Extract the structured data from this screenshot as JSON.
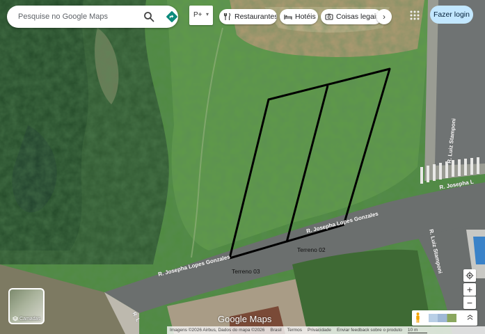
{
  "search": {
    "placeholder": "Pesquise no Google Maps",
    "search_icon": "search-icon",
    "directions_icon": "directions-icon"
  },
  "layer_picker": {
    "glyph": "P+",
    "caret": "▾"
  },
  "chips": [
    {
      "label": "Restaurantes",
      "icon": "restaurant-icon"
    },
    {
      "label": "Hotéis",
      "icon": "hotel-icon"
    },
    {
      "label": "Coisas legais p",
      "icon": "camera-icon"
    }
  ],
  "chip_next": "›",
  "login_label": "Fazer login",
  "layers_label": "Camadas",
  "street_labels": {
    "josepha_main": "R. Josepha Lopes Gonzales",
    "josepha_right": "R. Josepha Lopes Gonzales",
    "josepha_far": "R. Josepha L",
    "luiz_top": "R. Luiz Stamponi",
    "luiz_bottom": "R. Luiz Stamponi",
    "r_l": "R. L"
  },
  "plot_labels": {
    "terreno_02": "Terreno 02",
    "terreno_03": "Terreno 03"
  },
  "google_logo": "Google Maps",
  "footer": {
    "imagery": "Imagens ©2026 Airbus, Dados do mapa ©2026",
    "country": "Brasil",
    "terms": "Termos",
    "privacy": "Privacidade",
    "feedback": "Enviar feedback sobre o produto",
    "scale": "10 m"
  },
  "controls": {
    "locate_icon": "my-location-icon",
    "zoom_in": "+",
    "zoom_out": "−",
    "pegman_icon": "pegman-icon",
    "expand_icon": "expand-icon"
  },
  "colors": {
    "grass": "#4f8a3f",
    "forest": "#2f5730",
    "road": "#6b6f6e",
    "login_bg": "#c2e7ff"
  }
}
